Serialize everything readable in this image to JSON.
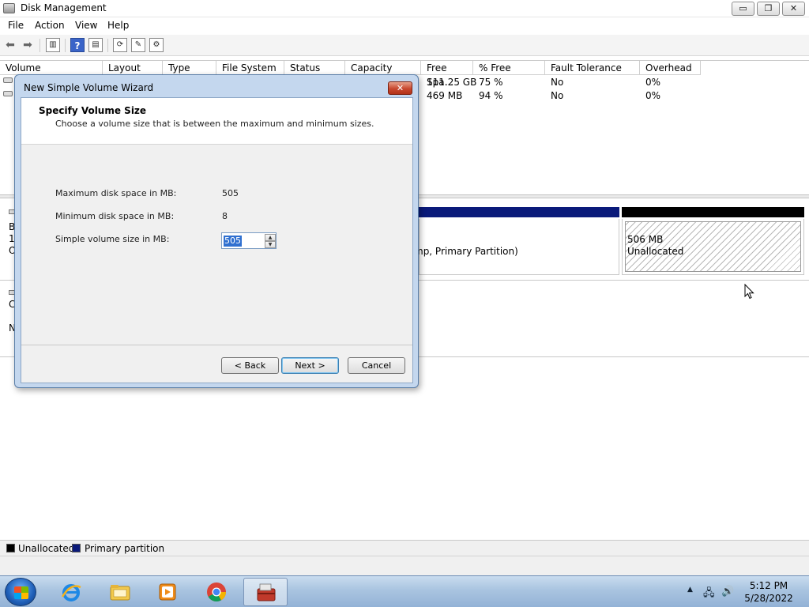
{
  "window": {
    "title": "Disk Management",
    "min_label": "▭",
    "max_label": "❐",
    "close_label": "✕"
  },
  "menu": [
    "File",
    "Action",
    "View",
    "Help"
  ],
  "volume_list": {
    "columns": [
      "Volume",
      "Layout",
      "Type",
      "File System",
      "Status",
      "Capacity",
      "Free Spa...",
      "% Free",
      "Fault Tolerance",
      "Overhead"
    ],
    "rows": [
      {
        "free_space": "111.25 GB",
        "percent_free": "75 %",
        "fault_tolerance": "No",
        "overhead": "0%"
      },
      {
        "free_space": "469 MB",
        "percent_free": "94 %",
        "fault_tolerance": "No",
        "overhead": "0%"
      }
    ]
  },
  "disk_view": {
    "left_fragments": [
      "B",
      "1",
      "O",
      "C",
      "N"
    ],
    "primary_partition_text": "mp, Primary Partition)",
    "unallocated_size": "506 MB",
    "unallocated_label": "Unallocated"
  },
  "legend": {
    "unallocated": "Unallocated",
    "primary": "Primary partition"
  },
  "colors": {
    "primary": "#0a1a7a",
    "unallocated": "#000000"
  },
  "dialog": {
    "title": "New Simple Volume Wizard",
    "close_label": "✕",
    "header_title": "Specify Volume Size",
    "header_subtitle": "Choose a volume size that is between the maximum and minimum sizes.",
    "max_label": "Maximum disk space in MB:",
    "max_value": "505",
    "min_label": "Minimum disk space in MB:",
    "min_value": "8",
    "size_label": "Simple volume size in MB:",
    "size_value": "505",
    "back_label": "< Back",
    "next_label": "Next >",
    "cancel_label": "Cancel"
  },
  "taskbar": {
    "clock_time": "5:12 PM",
    "clock_date": "5/28/2022",
    "icons": [
      "internet-explorer-icon",
      "file-explorer-icon",
      "media-player-icon",
      "chrome-icon",
      "computer-management-icon"
    ]
  }
}
